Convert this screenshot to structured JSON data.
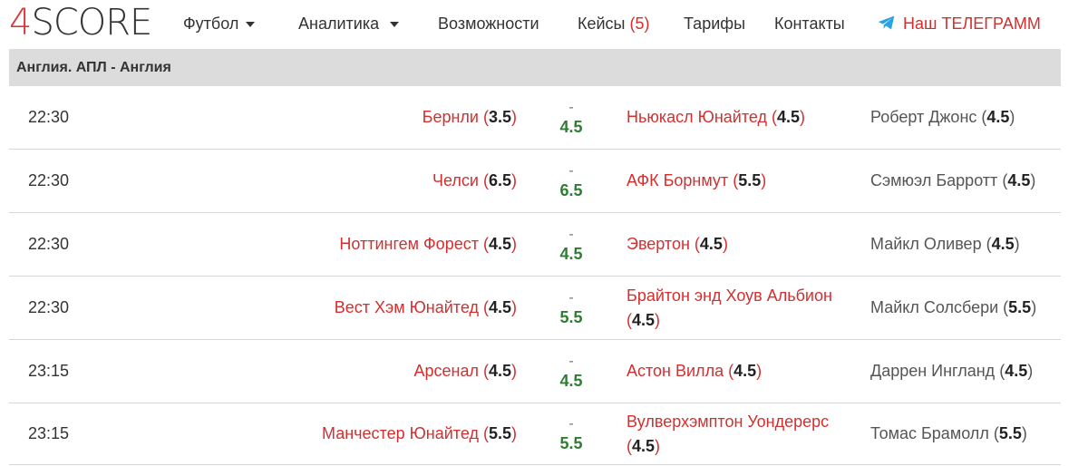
{
  "brand": {
    "logo_four": "4",
    "logo_rest": "SCORE"
  },
  "nav": {
    "football": "Футбол",
    "analytics": "Аналитика",
    "features": "Возможности",
    "cases": "Кейсы",
    "cases_count": "(5)",
    "pricing": "Тарифы",
    "contacts": "Контакты",
    "telegram": "Наш ТЕЛЕГРАММ"
  },
  "league": {
    "title": "Англия. АПЛ - Англия"
  },
  "matches": [
    {
      "time": "22:30",
      "home": "Бернли",
      "home_rating": "3.5",
      "dash": "-",
      "total": "4.5",
      "away": "Ньюкасл Юнайтед",
      "away_rating": "4.5",
      "referee": "Роберт Джонс",
      "referee_rating": "4.5"
    },
    {
      "time": "22:30",
      "home": "Челси",
      "home_rating": "6.5",
      "dash": "-",
      "total": "6.5",
      "away": "АФК Борнмут",
      "away_rating": "5.5",
      "referee": "Сэмюэл Барротт",
      "referee_rating": "4.5"
    },
    {
      "time": "22:30",
      "home": "Ноттингем Форест",
      "home_rating": "4.5",
      "dash": "-",
      "total": "4.5",
      "away": "Эвертон",
      "away_rating": "4.5",
      "referee": "Майкл Оливер",
      "referee_rating": "4.5"
    },
    {
      "time": "22:30",
      "home": "Вест Хэм Юнайтед",
      "home_rating": "4.5",
      "dash": "-",
      "total": "5.5",
      "away": "Брайтон энд Хоув Альбион",
      "away_rating": "4.5",
      "referee": "Майкл Солсбери",
      "referee_rating": "5.5"
    },
    {
      "time": "23:15",
      "home": "Арсенал",
      "home_rating": "4.5",
      "dash": "-",
      "total": "4.5",
      "away": "Астон Вилла",
      "away_rating": "4.5",
      "referee": "Даррен Ингланд",
      "referee_rating": "4.5"
    },
    {
      "time": "23:15",
      "home": "Манчестер Юнайтед",
      "home_rating": "5.5",
      "dash": "-",
      "total": "5.5",
      "away": "Вулверхэмптон Уондерерс",
      "away_rating": "4.5",
      "referee": "Томас Брамолл",
      "referee_rating": "5.5"
    }
  ],
  "colors": {
    "accent_red": "#d32f2f",
    "total_green": "#2e7d32",
    "league_bg": "#dcdcdc",
    "telegram_blue": "#2aa3e0"
  }
}
